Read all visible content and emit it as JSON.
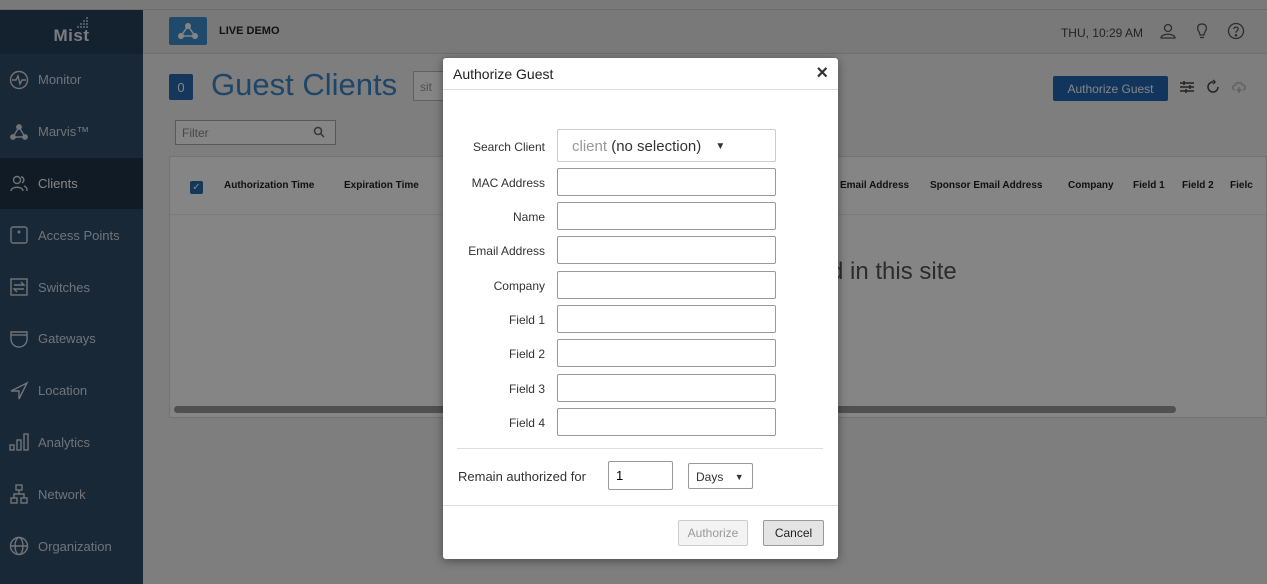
{
  "brand": {
    "logo_text": "Mist"
  },
  "header": {
    "site_label": "LIVE DEMO",
    "datetime": "THU, 10:29 AM",
    "icons": [
      "user-icon",
      "lightbulb-icon",
      "help-icon"
    ]
  },
  "sidebar": {
    "items": [
      {
        "label": "Monitor",
        "icon": "monitor-icon"
      },
      {
        "label": "Marvis™",
        "icon": "marvis-icon"
      },
      {
        "label": "Clients",
        "icon": "clients-icon",
        "active": true
      },
      {
        "label": "Access Points",
        "icon": "access-point-icon"
      },
      {
        "label": "Switches",
        "icon": "switch-icon"
      },
      {
        "label": "Gateways",
        "icon": "gateway-icon"
      },
      {
        "label": "Location",
        "icon": "location-icon"
      },
      {
        "label": "Analytics",
        "icon": "analytics-icon"
      },
      {
        "label": "Network",
        "icon": "network-icon"
      },
      {
        "label": "Organization",
        "icon": "organization-icon"
      }
    ]
  },
  "page": {
    "count": "0",
    "title": "Guest Clients",
    "site_placeholder": "sit",
    "authorize_guest_label": "Authorize Guest",
    "filter_placeholder": "Filter",
    "empty_message": "d in this site",
    "columns_left": [
      "Authorization Time",
      "Expiration Time"
    ],
    "columns_right": [
      "Email Address",
      "Sponsor Email Address",
      "Company",
      "Field 1",
      "Field 2",
      "Fielc"
    ]
  },
  "modal": {
    "title": "Authorize Guest",
    "close_label": "×",
    "search_client_label": "Search Client",
    "search_client_placeholder": "client",
    "search_client_value": "(no selection)",
    "fields": [
      {
        "label": "MAC Address",
        "value": ""
      },
      {
        "label": "Name",
        "value": ""
      },
      {
        "label": "Email Address",
        "value": ""
      },
      {
        "label": "Company",
        "value": ""
      },
      {
        "label": "Field 1",
        "value": ""
      },
      {
        "label": "Field 2",
        "value": ""
      },
      {
        "label": "Field 3",
        "value": ""
      },
      {
        "label": "Field 4",
        "value": ""
      }
    ],
    "remain_label": "Remain authorized for",
    "remain_value": "1",
    "remain_unit": "Days",
    "authorize_label": "Authorize",
    "cancel_label": "Cancel"
  },
  "colors": {
    "sidebar": "#2f4d6a",
    "accent": "#2166b0",
    "title": "#3b86c8"
  }
}
